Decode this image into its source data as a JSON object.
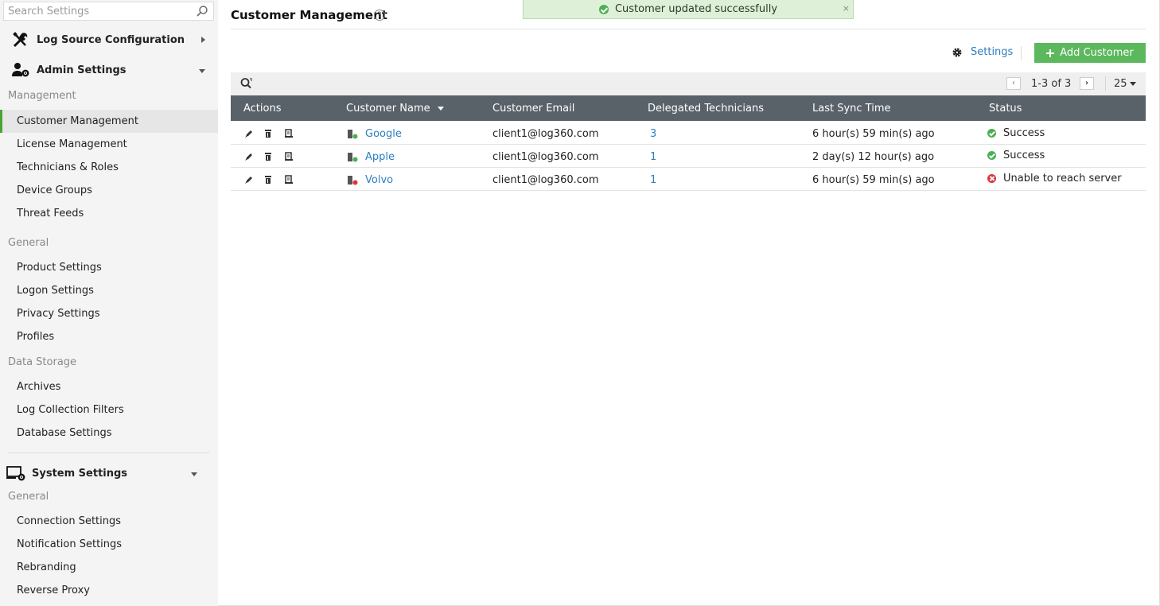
{
  "sidebar": {
    "search_placeholder": "Search Settings",
    "log_source": "Log Source Configuration",
    "admin_settings": "Admin Settings",
    "group_management": "Management",
    "management_items": [
      "Customer Management",
      "License Management",
      "Technicians & Roles",
      "Device Groups",
      "Threat Feeds"
    ],
    "group_general": "General",
    "general_items": [
      "Product Settings",
      "Logon Settings",
      "Privacy Settings",
      "Profiles"
    ],
    "group_data_storage": "Data Storage",
    "data_storage_items": [
      "Archives",
      "Log Collection Filters",
      "Database Settings"
    ],
    "system_settings": "System Settings",
    "group_general_2": "General",
    "system_items": [
      "Connection Settings",
      "Notification Settings",
      "Rebranding",
      "Reverse Proxy"
    ]
  },
  "page": {
    "title": "Customer Management",
    "help": "?",
    "toast": "Customer updated successfully",
    "toast_close": "×",
    "settings_label": "Settings",
    "add_customer_label": "Add Customer"
  },
  "pagination": {
    "range": "1-3 of 3",
    "page_size": "25",
    "prev": "‹",
    "next": "›"
  },
  "table": {
    "headers": [
      "Actions",
      "Customer Name",
      "Customer Email",
      "Delegated Technicians",
      "Last Sync Time",
      "Status"
    ],
    "rows": [
      {
        "name": "Google",
        "email": "client1@log360.com",
        "technicians": "3",
        "last_sync": "6 hour(s) 59 min(s) ago",
        "status": "Success",
        "status_type": "ok"
      },
      {
        "name": "Apple",
        "email": "client1@log360.com",
        "technicians": "1",
        "last_sync": "2 day(s) 12 hour(s) ago",
        "status": "Success",
        "status_type": "ok"
      },
      {
        "name": "Volvo",
        "email": "client1@log360.com",
        "technicians": "1",
        "last_sync": "6 hour(s) 59 min(s) ago",
        "status": "Unable to reach server",
        "status_type": "error"
      }
    ]
  },
  "colors": {
    "accent_green": "#5cb85c",
    "link_blue": "#2d7fc1",
    "header_gray": "#596169",
    "error_red": "#d9363e"
  },
  "icons": {
    "search": "search-icon",
    "log_source": "tools-icon",
    "admin": "user-gear-icon",
    "system": "monitor-gear-icon",
    "edit": "pencil-icon",
    "delete": "trash-icon",
    "details": "document-icon",
    "customer": "server-icon"
  }
}
